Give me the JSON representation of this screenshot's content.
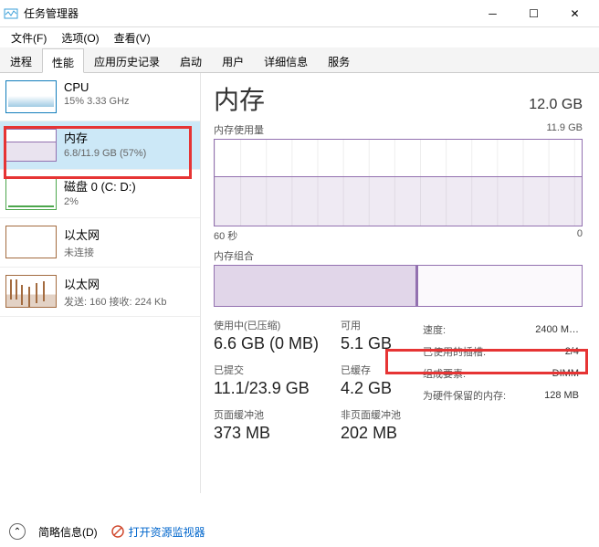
{
  "window": {
    "title": "任务管理器"
  },
  "menu": {
    "file": "文件(F)",
    "options": "选项(O)",
    "view": "查看(V)"
  },
  "tabs": [
    "进程",
    "性能",
    "应用历史记录",
    "启动",
    "用户",
    "详细信息",
    "服务"
  ],
  "sidebar": [
    {
      "title": "CPU",
      "sub": "15% 3.33 GHz"
    },
    {
      "title": "内存",
      "sub": "6.8/11.9 GB (57%)"
    },
    {
      "title": "磁盘 0 (C: D:)",
      "sub": "2%"
    },
    {
      "title": "以太网",
      "sub": "未连接"
    },
    {
      "title": "以太网",
      "sub": "发送: 160 接收: 224 Kb"
    }
  ],
  "main": {
    "title": "内存",
    "total": "12.0 GB",
    "usage_label": "内存使用量",
    "usage_max": "11.9 GB",
    "axis_left": "60 秒",
    "axis_right": "0",
    "composition_label": "内存组合"
  },
  "stats": {
    "in_use": {
      "lbl": "使用中(已压缩)",
      "val": "6.6 GB (0 MB)"
    },
    "available": {
      "lbl": "可用",
      "val": "5.1 GB"
    },
    "committed": {
      "lbl": "已提交",
      "val": "11.1/23.9 GB"
    },
    "cached": {
      "lbl": "已缓存",
      "val": "4.2 GB"
    },
    "paged": {
      "lbl": "页面缓冲池",
      "val": "373 MB"
    },
    "nonpaged": {
      "lbl": "非页面缓冲池",
      "val": "202 MB"
    }
  },
  "info": {
    "speed": {
      "k": "速度:",
      "v": "2400 M…"
    },
    "slots": {
      "k": "已使用的插槽:",
      "v": "2/4"
    },
    "form": {
      "k": "组成要素:",
      "v": "DIMM"
    },
    "reserved": {
      "k": "为硬件保留的内存:",
      "v": "128 MB"
    }
  },
  "footer": {
    "brief": "简略信息(D)",
    "monitor": "打开资源监视器"
  }
}
